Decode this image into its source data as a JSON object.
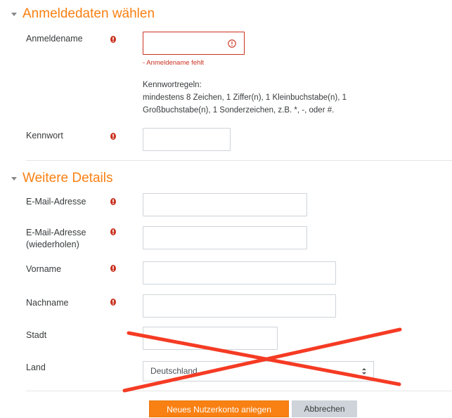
{
  "section_login": {
    "title": "Anmeldedaten wählen"
  },
  "username": {
    "label": "Anmeldename",
    "error": "- Anmeldename fehlt",
    "value": ""
  },
  "password_rules": {
    "heading": "Kennwortregeln:",
    "line1": "mindestens 8 Zeichen, 1 Ziffer(n), 1 Kleinbuchstabe(n), 1",
    "line2": "Großbuchstabe(n), 1 Sonderzeichen, z.B. *, -, oder #."
  },
  "password": {
    "label": "Kennwort",
    "value": ""
  },
  "section_details": {
    "title": "Weitere Details"
  },
  "email": {
    "label": "E-Mail-Adresse",
    "value": ""
  },
  "email_repeat": {
    "label_line1": "E-Mail-Adresse",
    "label_line2": "(wiederholen)",
    "value": ""
  },
  "firstname": {
    "label": "Vorname",
    "value": ""
  },
  "lastname": {
    "label": "Nachname",
    "value": ""
  },
  "city": {
    "label": "Stadt",
    "value": ""
  },
  "country": {
    "label": "Land",
    "selected": "Deutschland"
  },
  "buttons": {
    "submit": "Neues Nutzerkonto anlegen",
    "cancel": "Abbrechen"
  },
  "colors": {
    "accent": "#f98012",
    "error": "#ca3120",
    "required": "#ca3120",
    "cross": "#f53b24"
  },
  "icons": {
    "required": "exclamation-circle-icon",
    "caret": "caret-down-icon",
    "field_error": "error-circle-icon",
    "select": "select-arrows-icon"
  }
}
